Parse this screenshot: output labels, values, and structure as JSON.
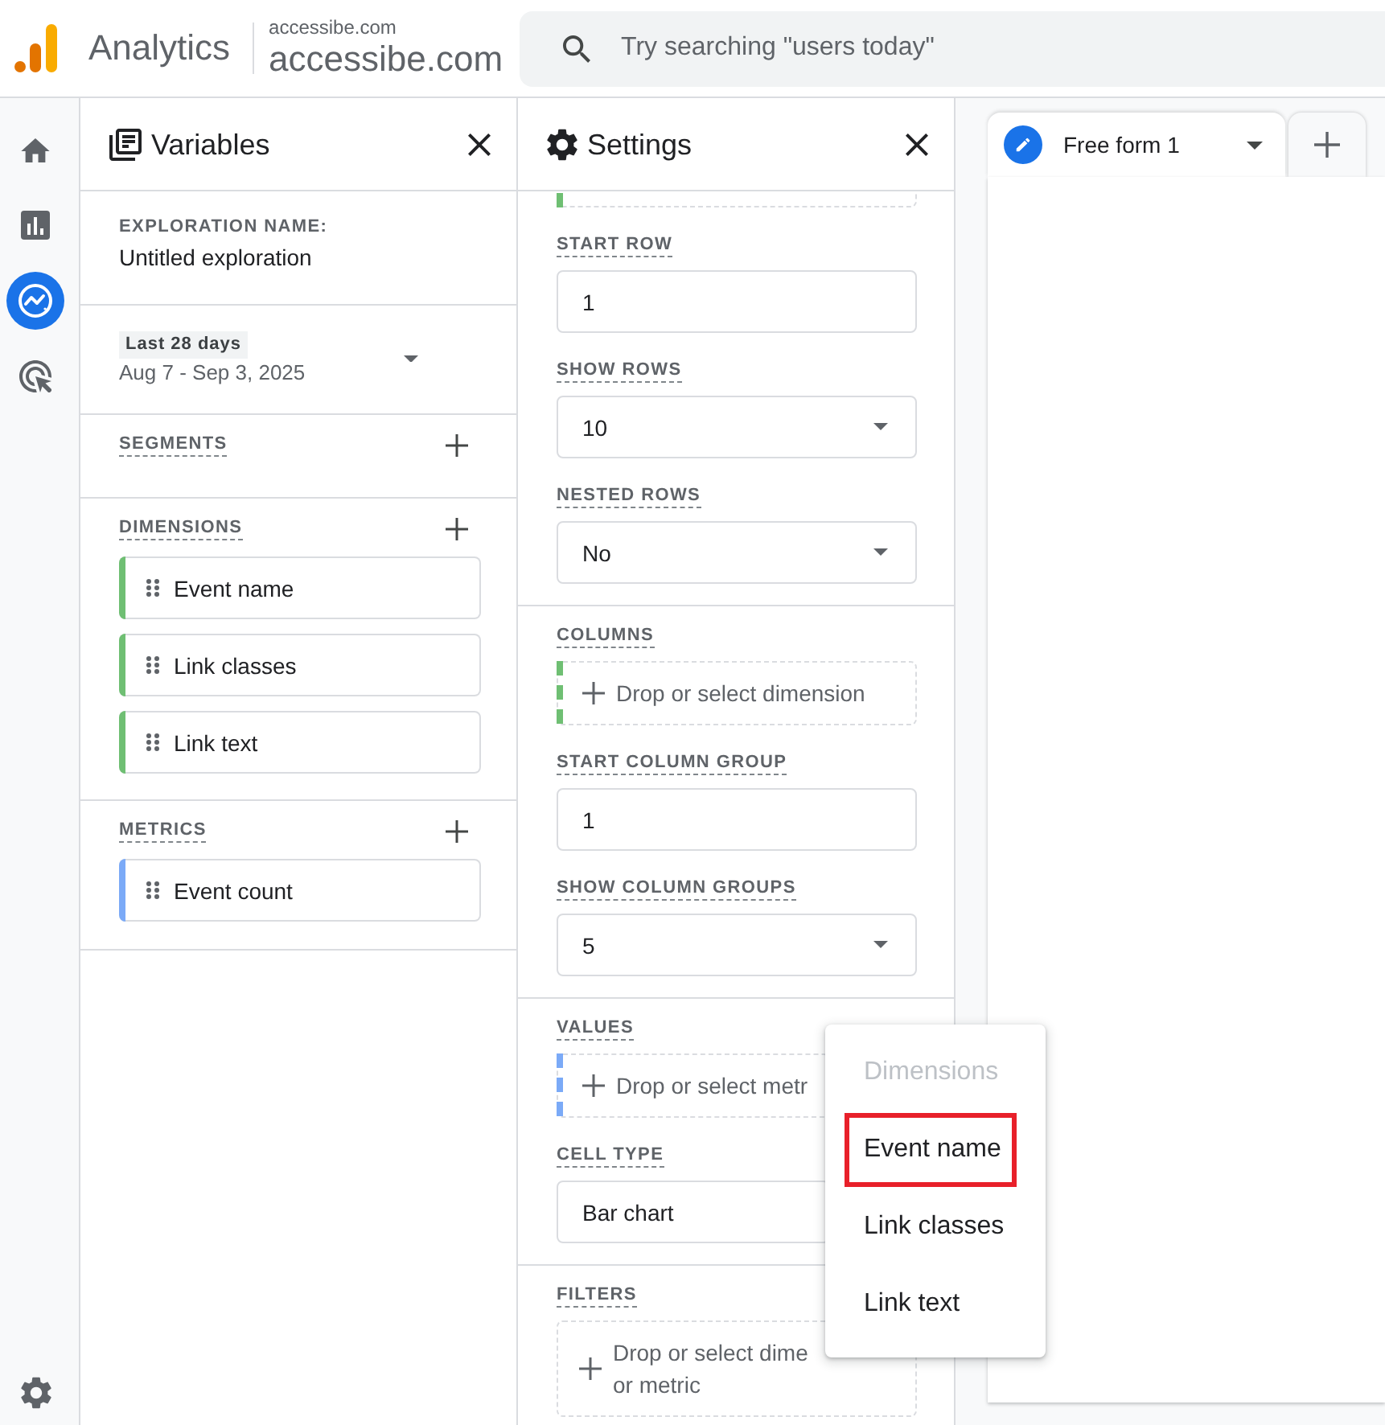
{
  "header": {
    "product_name": "Analytics",
    "account_name": "accessibe.com",
    "property_name": "accessibe.com",
    "search": {
      "placeholder": "Try searching \"users today\""
    }
  },
  "nav_rail": {
    "items": [
      {
        "kind": "home",
        "selected": false
      },
      {
        "kind": "reports",
        "selected": false
      },
      {
        "kind": "explore",
        "selected": true
      },
      {
        "kind": "advertising",
        "selected": false
      }
    ]
  },
  "variables_panel": {
    "title": "Variables",
    "exploration_name": {
      "label": "EXPLORATION NAME:",
      "value": "Untitled exploration"
    },
    "date_range": {
      "preset": "Last 28 days",
      "range": "Aug 7 - Sep 3, 2025"
    },
    "sections": [
      {
        "label": "SEGMENTS"
      },
      {
        "label": "DIMENSIONS",
        "items": [
          {
            "label": "Event name",
            "color": "#6fbf73"
          },
          {
            "label": "Link classes",
            "color": "#6fbf73"
          },
          {
            "label": "Link text",
            "color": "#6fbf73"
          }
        ]
      },
      {
        "label": "METRICS",
        "items": [
          {
            "label": "Event count",
            "color": "#7baaf7"
          }
        ]
      }
    ]
  },
  "settings_panel": {
    "title": "Settings",
    "groups": [
      {
        "fields": [
          {
            "kind": "drop_zone",
            "color": "#6fbf73"
          },
          {
            "kind": "input",
            "label": "START ROW",
            "value": "1"
          },
          {
            "kind": "select",
            "label": "SHOW ROWS",
            "value": "10"
          },
          {
            "kind": "select",
            "label": "NESTED ROWS",
            "value": "No"
          }
        ]
      },
      {
        "fields": [
          {
            "kind": "drop_zone",
            "label": "COLUMNS",
            "prompt": "Drop or select dimension",
            "color": "#6fbf73"
          },
          {
            "kind": "input",
            "label": "START COLUMN GROUP",
            "value": "1"
          },
          {
            "kind": "select",
            "label": "SHOW COLUMN GROUPS",
            "value": "5"
          }
        ]
      },
      {
        "fields": [
          {
            "kind": "drop_zone",
            "label": "VALUES",
            "prompt": "Drop or select metr",
            "color": "#7baaf7"
          },
          {
            "kind": "input",
            "label": "CELL TYPE",
            "value": "Bar chart"
          }
        ]
      },
      {
        "fields": [
          {
            "kind": "drop_zone",
            "label": "FILTERS",
            "prompt": "Drop or select dime\nor metric"
          }
        ]
      }
    ]
  },
  "tabs": {
    "items": [
      {
        "label": "Free form 1",
        "selected": true
      }
    ]
  },
  "dropdown_menu": {
    "header": "Dimensions",
    "items": [
      {
        "label": "Event name",
        "highlighted": true
      },
      {
        "label": "Link classes",
        "highlighted": false
      },
      {
        "label": "Link text",
        "highlighted": false
      }
    ]
  }
}
